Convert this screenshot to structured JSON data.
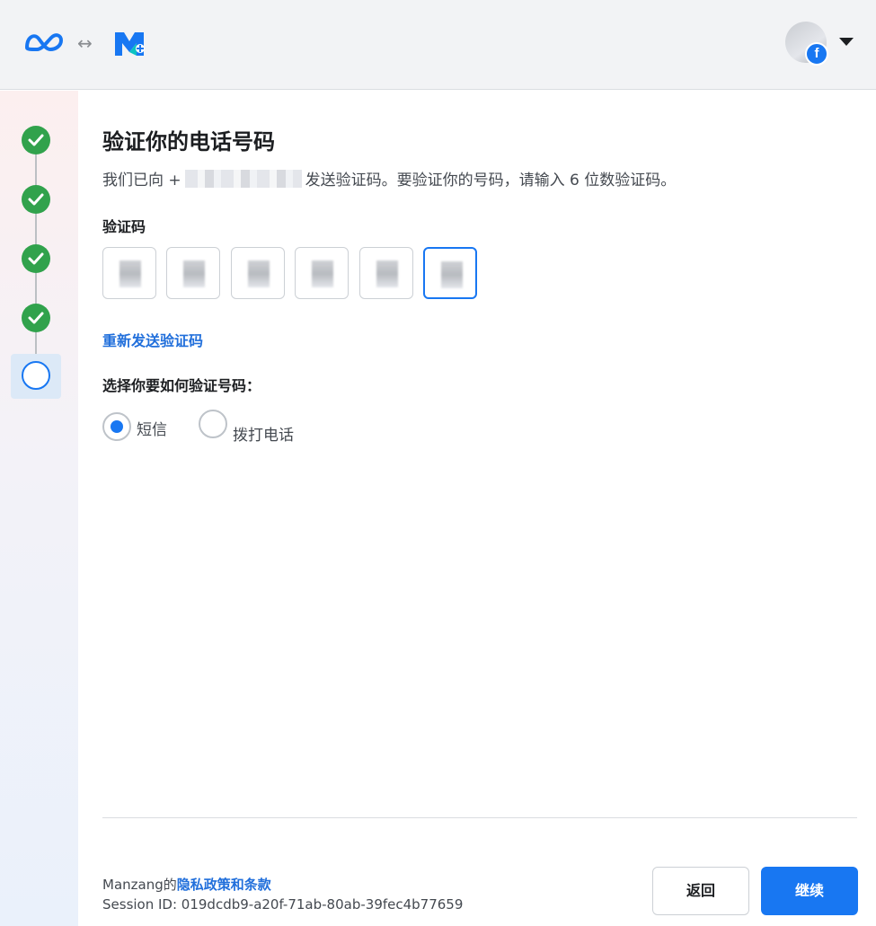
{
  "header": {
    "logos": [
      "meta-logo-icon",
      "swap-arrow-icon",
      "meta-business-suite-logo-icon"
    ],
    "arrow_glyph": "↔",
    "avatar_badge": "f"
  },
  "steps": {
    "completed": 4,
    "current_index": 4
  },
  "main": {
    "title": "验证你的电话号码",
    "desc_prefix": "我们已向 +",
    "desc_suffix": "发送验证码。要验证你的号码，请输入 6 位数验证码。",
    "code_label": "验证码",
    "code_boxes": [
      "",
      "",
      "",
      "",
      "",
      ""
    ],
    "resend_link": "重新发送验证码",
    "method_label": "选择你要如何验证号码：",
    "methods": [
      {
        "label": "短信",
        "checked": true
      },
      {
        "label": "拨打电话",
        "checked": false
      }
    ]
  },
  "footer": {
    "owner": "Manzang的",
    "policy_link": "隐私政策和条款",
    "session": "Session ID: 019dcdb9-a20f-71ab-80ab-39fec4b77659",
    "back_label": "返回",
    "next_label": "继续"
  },
  "colors": {
    "primary": "#1877f2",
    "link": "#216fdb",
    "success": "#31a24c"
  }
}
